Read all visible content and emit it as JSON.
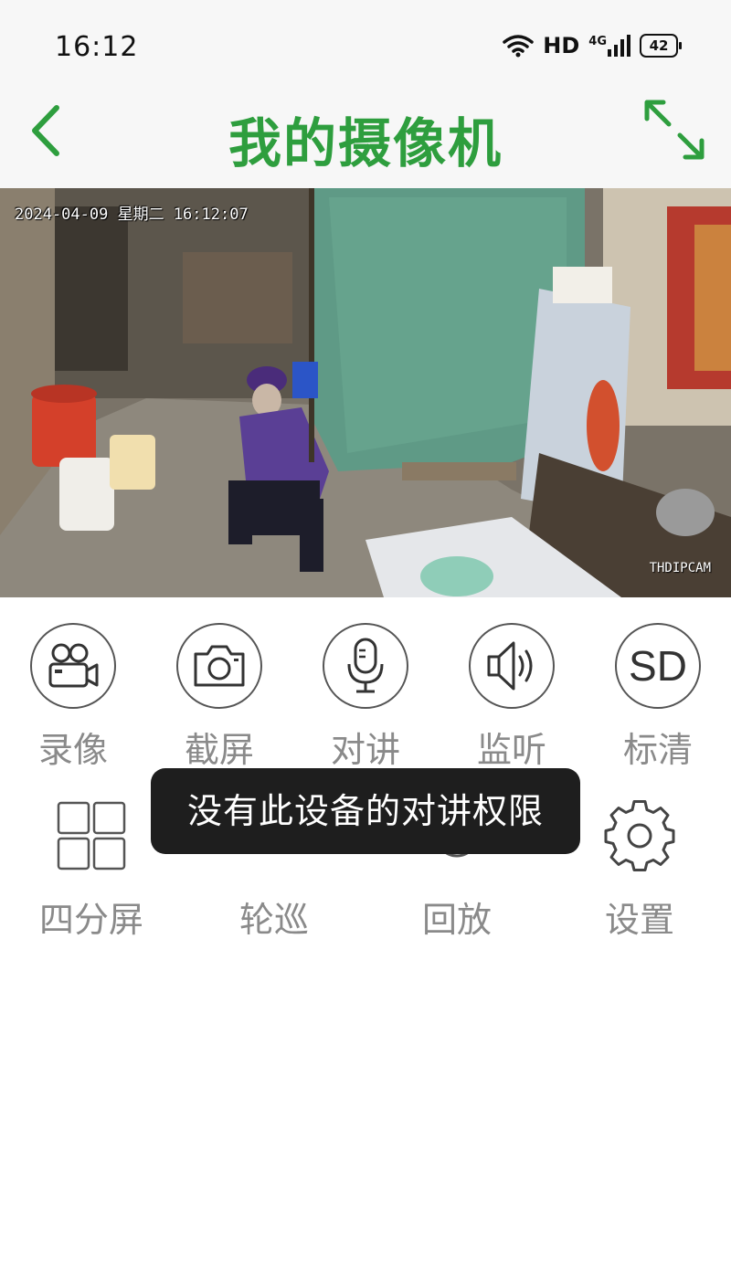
{
  "status_bar": {
    "time": "16:12",
    "hd": "HD",
    "network": "4G",
    "battery": "42"
  },
  "header": {
    "title": "我的摄像机"
  },
  "video": {
    "timestamp": "2024-04-09 星期二 16:12:07",
    "watermark": "THDIPCAM"
  },
  "controls_row1": [
    {
      "label": "录像",
      "icon": "video-camera-icon"
    },
    {
      "label": "截屏",
      "icon": "camera-icon"
    },
    {
      "label": "对讲",
      "icon": "microphone-icon"
    },
    {
      "label": "监听",
      "icon": "speaker-icon"
    },
    {
      "label": "标清",
      "icon": "sd-icon",
      "icon_text": "SD"
    }
  ],
  "controls_row2": [
    {
      "label": "四分屏",
      "icon": "quad-grid-icon"
    },
    {
      "label": "轮巡",
      "icon": "patrol-icon"
    },
    {
      "label": "回放",
      "icon": "playback-icon"
    },
    {
      "label": "设置",
      "icon": "gear-icon"
    }
  ],
  "toast": {
    "message": "没有此设备的对讲权限"
  },
  "colors": {
    "accent": "#2e9e3e",
    "label_gray": "#8a8a8a",
    "icon_dark": "#555555",
    "toast_bg": "#1e1e1e"
  }
}
